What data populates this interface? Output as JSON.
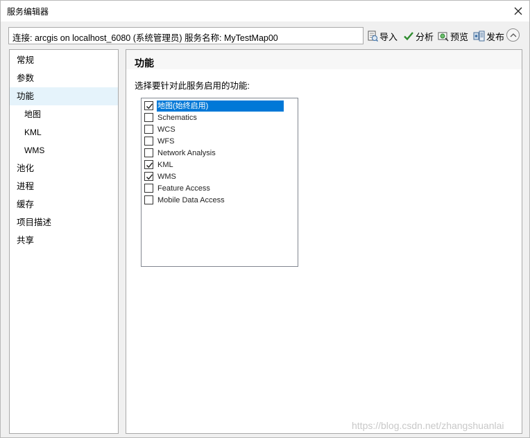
{
  "window": {
    "title": "服务编辑器"
  },
  "toolbar": {
    "connection_text": "连接: arcgis on localhost_6080 (系统管理员)    服务名称: MyTestMap00",
    "import_label": "导入",
    "analyze_label": "分析",
    "preview_label": "预览",
    "publish_label": "发布"
  },
  "sidebar": {
    "items": [
      {
        "label": "常规"
      },
      {
        "label": "参数"
      },
      {
        "label": "功能"
      },
      {
        "label": "地图"
      },
      {
        "label": "KML"
      },
      {
        "label": "WMS"
      },
      {
        "label": "池化"
      },
      {
        "label": "进程"
      },
      {
        "label": "缓存"
      },
      {
        "label": "项目描述"
      },
      {
        "label": "共享"
      }
    ]
  },
  "main": {
    "heading": "功能",
    "description": "选择要针对此服务启用的功能:",
    "capabilities": [
      {
        "label": "地图(始终启用)",
        "checked": true
      },
      {
        "label": "Schematics",
        "checked": false
      },
      {
        "label": "WCS",
        "checked": false
      },
      {
        "label": "WFS",
        "checked": false
      },
      {
        "label": "Network Analysis",
        "checked": false
      },
      {
        "label": "KML",
        "checked": true
      },
      {
        "label": "WMS",
        "checked": true
      },
      {
        "label": "Feature Access",
        "checked": false
      },
      {
        "label": "Mobile Data Access",
        "checked": false
      }
    ]
  },
  "watermark": "https://blog.csdn.net/zhangshuanlai",
  "colors": {
    "selection": "#0078d7",
    "nav_active": "#e5f3fb",
    "analyze_check": "#2e8b2e"
  }
}
